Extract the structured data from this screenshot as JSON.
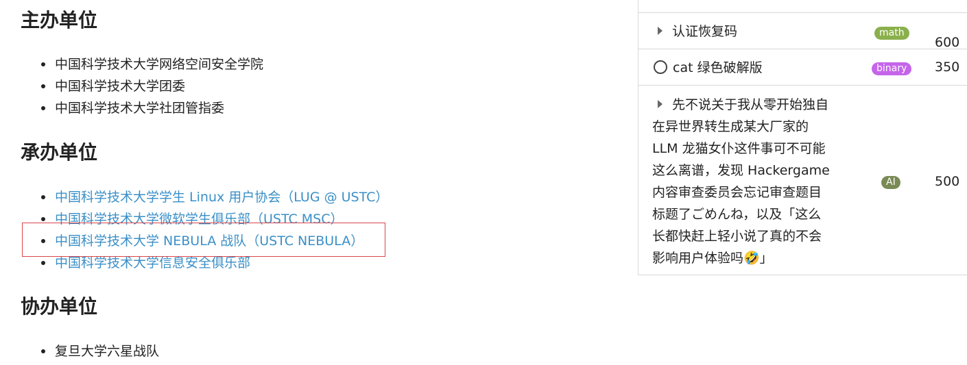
{
  "sections": {
    "host": {
      "heading": "主办单位",
      "items": [
        "中国科学技术大学网络空间安全学院",
        "中国科学技术大学团委",
        "中国科学技术大学社团管指委"
      ]
    },
    "organizer": {
      "heading": "承办单位",
      "items": [
        "中国科学技术大学学生 Linux 用户协会（LUG @ USTC）",
        "中国科学技术大学微软学生俱乐部（USTC MSC）",
        "中国科学技术大学 NEBULA 战队（USTC NEBULA）",
        "中国科学技术大学信息安全俱乐部"
      ]
    },
    "coorganizer": {
      "heading": "协办单位",
      "items": [
        "复旦大学六星战队"
      ]
    }
  },
  "challenges": [
    {
      "title": "认证恢复码",
      "category": "math",
      "category_color": "#8ab04c",
      "score": "600",
      "icon": "caret-right-icon"
    },
    {
      "title": "cat 绿色破解版",
      "category": "binary",
      "category_color": "#c565ea",
      "score": "350",
      "icon": "circle-icon"
    },
    {
      "title_lines": [
        "先不说关于我从零开始独自",
        "在异世界转生成某大厂家的",
        "LLM 龙猫女仆这件事可不可能",
        "这么离谱，发现 Hackergame",
        "内容审查委员会忘记审查题目",
        "标题了ごめんね，以及「这么",
        "长都快赶上轻小说了真的不会",
        "影响用户体验吗🤣」"
      ],
      "category": "AI",
      "category_color": "#7a8a55",
      "score": "500",
      "icon": "caret-right-icon"
    }
  ]
}
